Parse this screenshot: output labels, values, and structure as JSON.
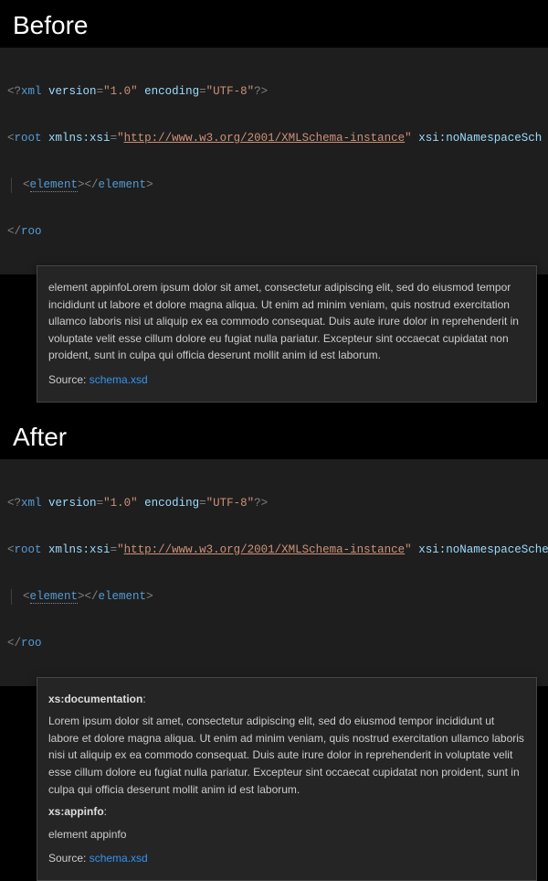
{
  "before": {
    "title": "Before",
    "code": {
      "line1": {
        "open": "<?",
        "tag": "xml",
        "attr1": "version",
        "val1": "\"1.0\"",
        "attr2": "encoding",
        "val2": "\"UTF-8\"",
        "close": "?>"
      },
      "line2": {
        "open": "<",
        "tag": "root",
        "attr1": "xmlns:xsi",
        "val1_pre": "\"",
        "val1_link": "http://www.w3.org/2001/XMLSchema-instance",
        "val1_post": "\"",
        "attr2": "xsi:noNamespaceSch"
      },
      "line3": {
        "open": "<",
        "tag_open": "element",
        "mid": "></",
        "tag_close": "element",
        "close": ">"
      },
      "line4": {
        "open": "</",
        "tag": "roo"
      }
    },
    "hover": {
      "text": "element appinfoLorem ipsum dolor sit amet, consectetur adipiscing elit, sed do eiusmod tempor incididunt ut labore et dolore magna aliqua. Ut enim ad minim veniam, quis nostrud exercitation ullamco laboris nisi ut aliquip ex ea commodo consequat. Duis aute irure dolor in reprehenderit in voluptate velit esse cillum dolore eu fugiat nulla pariatur. Excepteur sint occaecat cupidatat non proident, sunt in culpa qui officia deserunt mollit anim id est laborum.",
      "source_label": "Source: ",
      "source_link": "schema.xsd"
    }
  },
  "after": {
    "title": "After",
    "code": {
      "line1": {
        "open": "<?",
        "tag": "xml",
        "attr1": "version",
        "val1": "\"1.0\"",
        "attr2": "encoding",
        "val2": "\"UTF-8\"",
        "close": "?>"
      },
      "line2": {
        "open": "<",
        "tag": "root",
        "attr1": "xmlns:xsi",
        "val1_pre": "\"",
        "val1_link": "http://www.w3.org/2001/XMLSchema-instance",
        "val1_post": "\"",
        "attr2": "xsi:noNamespaceSche"
      },
      "line3": {
        "open": "<",
        "tag_open": "element",
        "mid": "></",
        "tag_close": "element",
        "close": ">"
      },
      "line4": {
        "open": "</",
        "tag": "roo"
      }
    },
    "hover": {
      "doc_label": "xs:documentation",
      "doc_colon": ":",
      "doc_text": "Lorem ipsum dolor sit amet, consectetur adipiscing elit, sed do eiusmod tempor incididunt ut labore et dolore magna aliqua. Ut enim ad minim veniam, quis nostrud exercitation ullamco laboris nisi ut aliquip ex ea commodo consequat. Duis aute irure dolor in reprehenderit in voluptate velit esse cillum dolore eu fugiat nulla pariatur. Excepteur sint occaecat cupidatat non proident, sunt in culpa qui officia deserunt mollit anim id est laborum.",
      "appinfo_label": "xs:appinfo",
      "appinfo_colon": ":",
      "appinfo_text": "element appinfo",
      "source_label": "Source: ",
      "source_link": "schema.xsd"
    }
  }
}
